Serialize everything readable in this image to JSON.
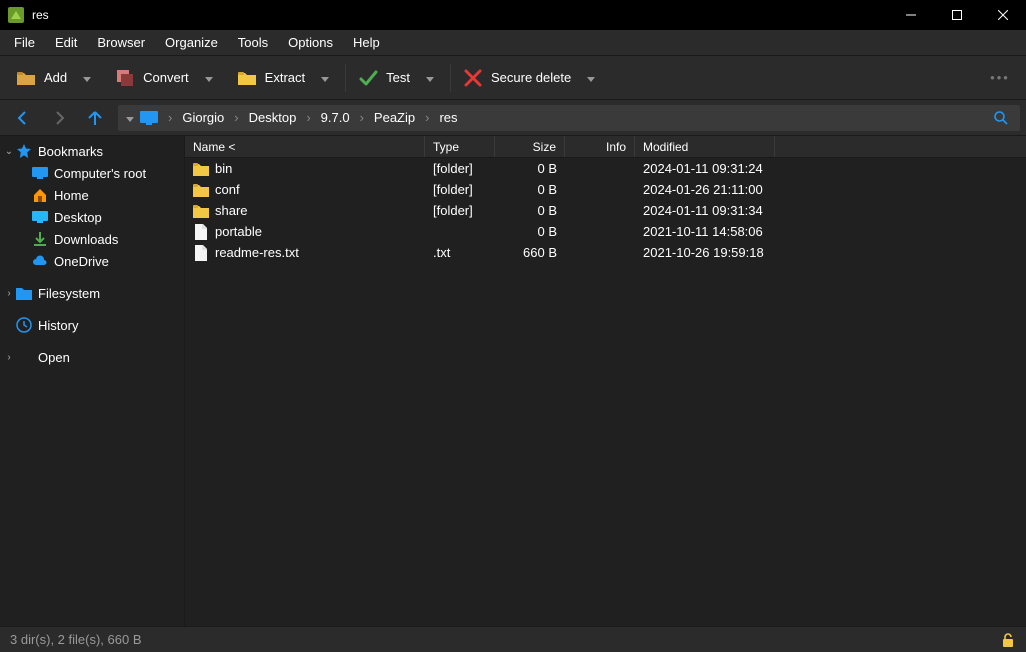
{
  "title": "res",
  "menu": [
    "File",
    "Edit",
    "Browser",
    "Organize",
    "Tools",
    "Options",
    "Help"
  ],
  "toolbar": {
    "add": "Add",
    "convert": "Convert",
    "extract": "Extract",
    "test": "Test",
    "secure_delete": "Secure delete"
  },
  "breadcrumb": [
    "Giorgio",
    "Desktop",
    "9.7.0",
    "PeaZip",
    "res"
  ],
  "sidebar": {
    "bookmarks": "Bookmarks",
    "computer_root": "Computer's root",
    "home": "Home",
    "desktop": "Desktop",
    "downloads": "Downloads",
    "onedrive": "OneDrive",
    "filesystem": "Filesystem",
    "history": "History",
    "open": "Open"
  },
  "columns": {
    "name": "Name <",
    "type": "Type",
    "size": "Size",
    "info": "Info",
    "modified": "Modified"
  },
  "files": [
    {
      "name": "bin",
      "type": "[folder]",
      "size": "0 B",
      "info": "",
      "mod": "2024-01-11 09:31:24",
      "icon": "folder"
    },
    {
      "name": "conf",
      "type": "[folder]",
      "size": "0 B",
      "info": "",
      "mod": "2024-01-26 21:11:00",
      "icon": "folder"
    },
    {
      "name": "share",
      "type": "[folder]",
      "size": "0 B",
      "info": "",
      "mod": "2024-01-11 09:31:34",
      "icon": "folder"
    },
    {
      "name": "portable",
      "type": "",
      "size": "0 B",
      "info": "",
      "mod": "2021-10-11 14:58:06",
      "icon": "file"
    },
    {
      "name": "readme-res.txt",
      "type": ".txt",
      "size": "660 B",
      "info": "",
      "mod": "2021-10-26 19:59:18",
      "icon": "file"
    }
  ],
  "status": "3 dir(s), 2 file(s), 660 B"
}
